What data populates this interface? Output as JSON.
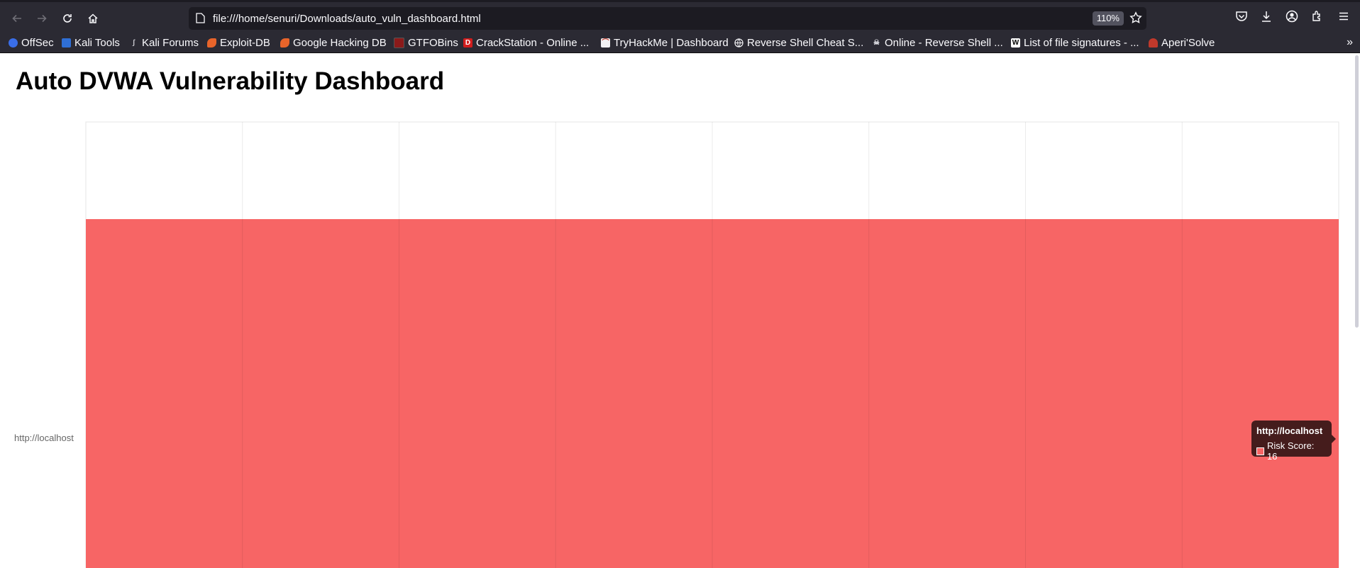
{
  "browser": {
    "url": "file:///home/senuri/Downloads/auto_vuln_dashboard.html",
    "zoom": "110%",
    "bookmarks": [
      {
        "label": "OffSec",
        "icon": "offsec-icon",
        "color": "#3a6ee8"
      },
      {
        "label": "Kali Tools",
        "icon": "kali-tools-icon",
        "color": "#2f6fd6"
      },
      {
        "label": "Kali Forums",
        "icon": "kali-forums-icon",
        "color": "#8c8c96"
      },
      {
        "label": "Exploit-DB",
        "icon": "exploit-db-icon",
        "color": "#e8642a"
      },
      {
        "label": "Google Hacking DB",
        "icon": "ghdb-icon",
        "color": "#e8642a"
      },
      {
        "label": "GTFOBins",
        "icon": "gtfobins-icon",
        "color": "#8b1a1a"
      },
      {
        "label": "CrackStation - Online ...",
        "icon": "crackstation-icon",
        "color": "#d11d1d"
      },
      {
        "label": "TryHackMe | Dashboard",
        "icon": "tryhackme-icon",
        "color": "#c9c9cf"
      },
      {
        "label": "Reverse Shell Cheat S...",
        "icon": "globe-icon",
        "color": "#2b2a33"
      },
      {
        "label": "Online - Reverse Shell ...",
        "icon": "skull-icon",
        "color": "#2b2a33"
      },
      {
        "label": "List of file signatures - ...",
        "icon": "wikipedia-icon",
        "color": "#ffffff"
      },
      {
        "label": "Aperi'Solve",
        "icon": "aperisolve-icon",
        "color": "#c0392b"
      }
    ]
  },
  "page": {
    "title": "Auto DVWA Vulnerability Dashboard"
  },
  "chart_data": {
    "type": "bar",
    "orientation": "horizontal",
    "categories": [
      "http://localhost"
    ],
    "series": [
      {
        "name": "Risk Score",
        "values": [
          16
        ],
        "color": "#f76565"
      }
    ],
    "xlim": [
      0,
      16
    ],
    "grid": true,
    "tooltip": {
      "title": "http://localhost",
      "label": "Risk Score: 16"
    }
  }
}
